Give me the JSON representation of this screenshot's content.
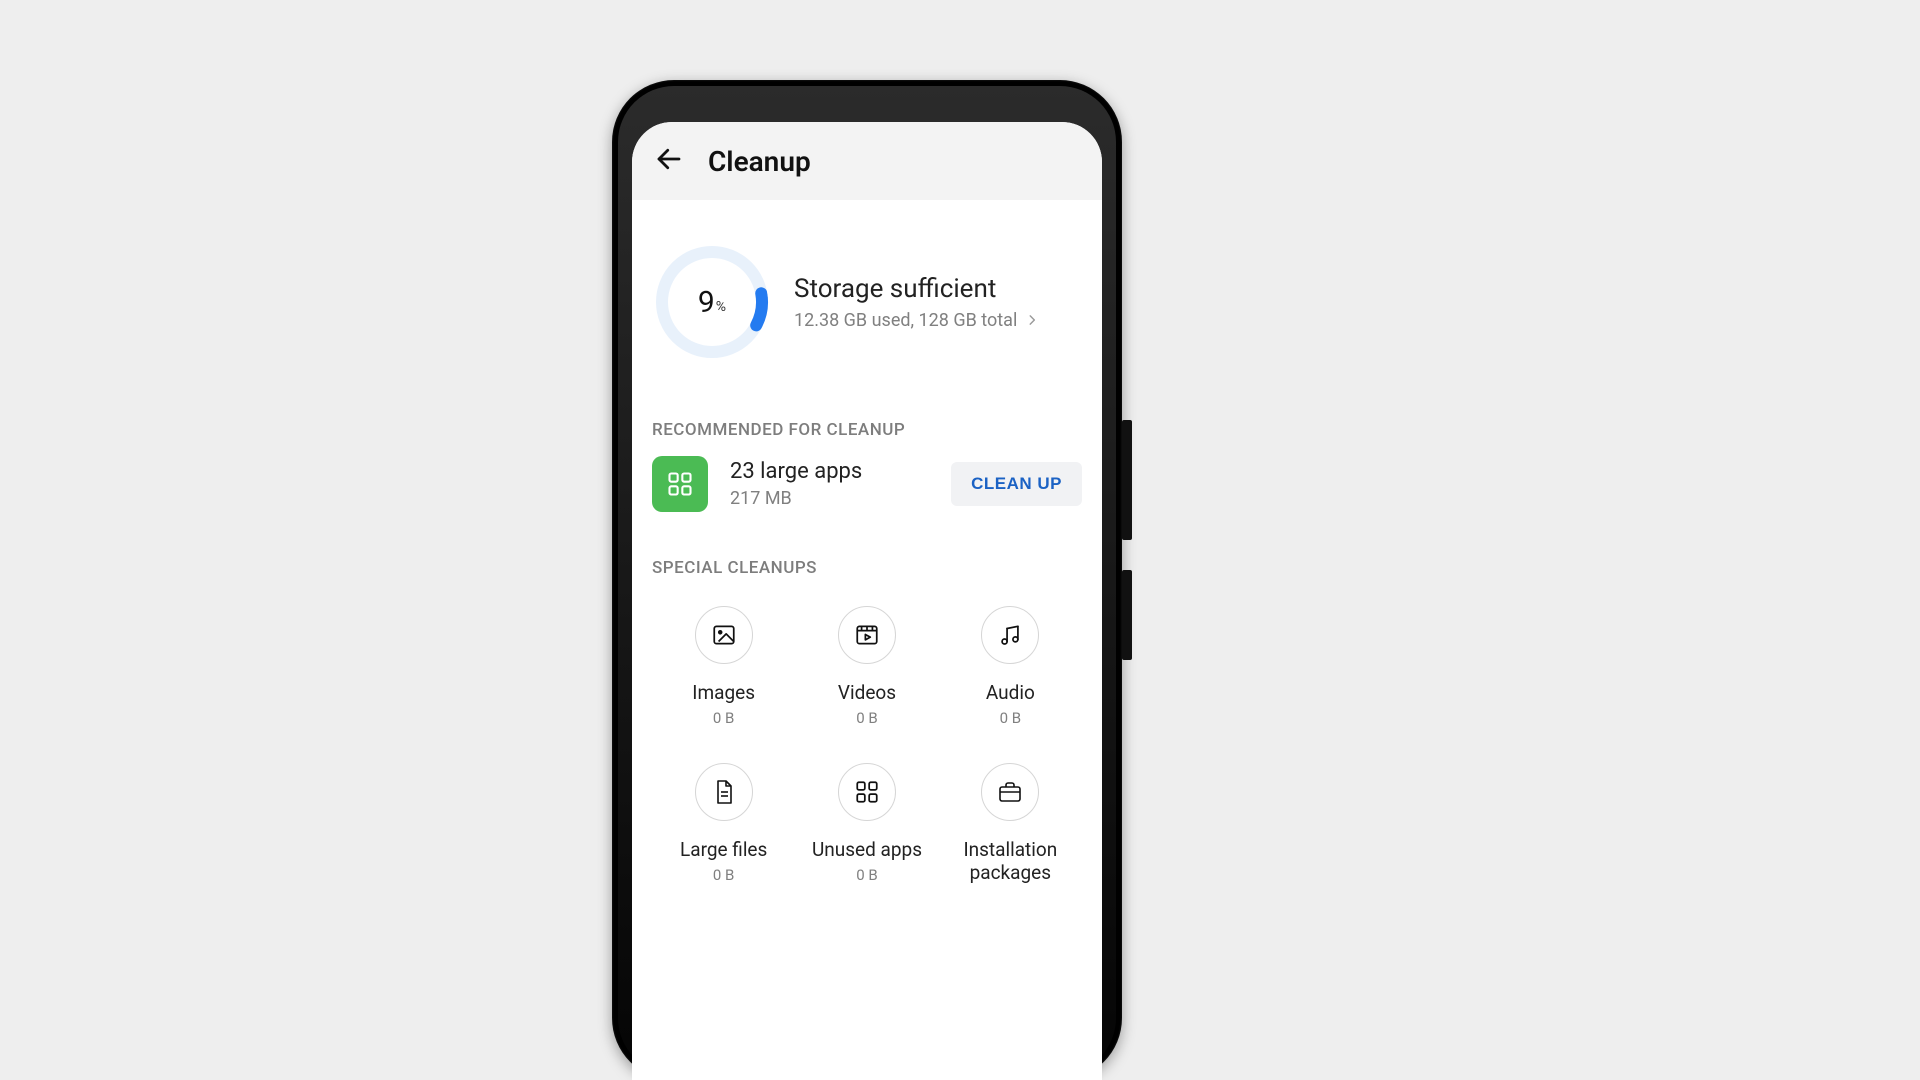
{
  "appbar": {
    "title": "Cleanup"
  },
  "storage": {
    "percent_number": "9",
    "percent_unit": "%",
    "status_title": "Storage sufficient",
    "status_sub": "12.38 GB used, 128 GB total"
  },
  "sections": {
    "recommended_label": "RECOMMENDED FOR CLEANUP",
    "special_label": "SPECIAL CLEANUPS"
  },
  "recommended": {
    "title": "23 large apps",
    "size": "217 MB",
    "button_label": "CLEAN UP"
  },
  "special_cleanups": [
    {
      "icon": "images-icon",
      "label": "Images",
      "size": "0 B"
    },
    {
      "icon": "videos-icon",
      "label": "Videos",
      "size": "0 B"
    },
    {
      "icon": "audio-icon",
      "label": "Audio",
      "size": "0 B"
    },
    {
      "icon": "large-files-icon",
      "label": "Large files",
      "size": "0 B"
    },
    {
      "icon": "unused-apps-icon",
      "label": "Unused apps",
      "size": "0 B"
    },
    {
      "icon": "install-packages-icon",
      "label": "Installation packages",
      "size": ""
    }
  ],
  "colors": {
    "accent_blue": "#247bf0",
    "button_blue": "#1b62c4",
    "app_green": "#4bbb54"
  }
}
